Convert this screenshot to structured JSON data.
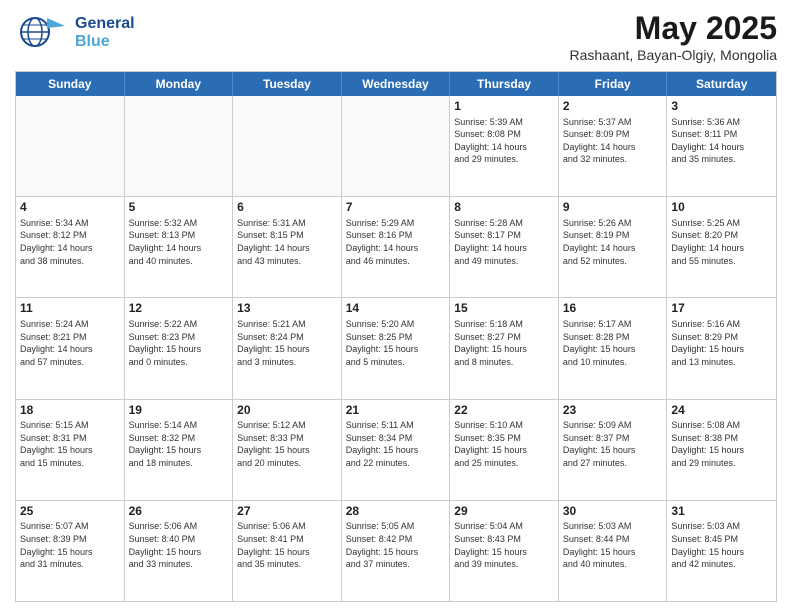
{
  "logo": {
    "general": "General",
    "blue": "Blue"
  },
  "title": "May 2025",
  "subtitle": "Rashaant, Bayan-Olgiy, Mongolia",
  "days": [
    "Sunday",
    "Monday",
    "Tuesday",
    "Wednesday",
    "Thursday",
    "Friday",
    "Saturday"
  ],
  "weeks": [
    [
      {
        "num": "",
        "info": ""
      },
      {
        "num": "",
        "info": ""
      },
      {
        "num": "",
        "info": ""
      },
      {
        "num": "",
        "info": ""
      },
      {
        "num": "1",
        "info": "Sunrise: 5:39 AM\nSunset: 8:08 PM\nDaylight: 14 hours\nand 29 minutes."
      },
      {
        "num": "2",
        "info": "Sunrise: 5:37 AM\nSunset: 8:09 PM\nDaylight: 14 hours\nand 32 minutes."
      },
      {
        "num": "3",
        "info": "Sunrise: 5:36 AM\nSunset: 8:11 PM\nDaylight: 14 hours\nand 35 minutes."
      }
    ],
    [
      {
        "num": "4",
        "info": "Sunrise: 5:34 AM\nSunset: 8:12 PM\nDaylight: 14 hours\nand 38 minutes."
      },
      {
        "num": "5",
        "info": "Sunrise: 5:32 AM\nSunset: 8:13 PM\nDaylight: 14 hours\nand 40 minutes."
      },
      {
        "num": "6",
        "info": "Sunrise: 5:31 AM\nSunset: 8:15 PM\nDaylight: 14 hours\nand 43 minutes."
      },
      {
        "num": "7",
        "info": "Sunrise: 5:29 AM\nSunset: 8:16 PM\nDaylight: 14 hours\nand 46 minutes."
      },
      {
        "num": "8",
        "info": "Sunrise: 5:28 AM\nSunset: 8:17 PM\nDaylight: 14 hours\nand 49 minutes."
      },
      {
        "num": "9",
        "info": "Sunrise: 5:26 AM\nSunset: 8:19 PM\nDaylight: 14 hours\nand 52 minutes."
      },
      {
        "num": "10",
        "info": "Sunrise: 5:25 AM\nSunset: 8:20 PM\nDaylight: 14 hours\nand 55 minutes."
      }
    ],
    [
      {
        "num": "11",
        "info": "Sunrise: 5:24 AM\nSunset: 8:21 PM\nDaylight: 14 hours\nand 57 minutes."
      },
      {
        "num": "12",
        "info": "Sunrise: 5:22 AM\nSunset: 8:23 PM\nDaylight: 15 hours\nand 0 minutes."
      },
      {
        "num": "13",
        "info": "Sunrise: 5:21 AM\nSunset: 8:24 PM\nDaylight: 15 hours\nand 3 minutes."
      },
      {
        "num": "14",
        "info": "Sunrise: 5:20 AM\nSunset: 8:25 PM\nDaylight: 15 hours\nand 5 minutes."
      },
      {
        "num": "15",
        "info": "Sunrise: 5:18 AM\nSunset: 8:27 PM\nDaylight: 15 hours\nand 8 minutes."
      },
      {
        "num": "16",
        "info": "Sunrise: 5:17 AM\nSunset: 8:28 PM\nDaylight: 15 hours\nand 10 minutes."
      },
      {
        "num": "17",
        "info": "Sunrise: 5:16 AM\nSunset: 8:29 PM\nDaylight: 15 hours\nand 13 minutes."
      }
    ],
    [
      {
        "num": "18",
        "info": "Sunrise: 5:15 AM\nSunset: 8:31 PM\nDaylight: 15 hours\nand 15 minutes."
      },
      {
        "num": "19",
        "info": "Sunrise: 5:14 AM\nSunset: 8:32 PM\nDaylight: 15 hours\nand 18 minutes."
      },
      {
        "num": "20",
        "info": "Sunrise: 5:12 AM\nSunset: 8:33 PM\nDaylight: 15 hours\nand 20 minutes."
      },
      {
        "num": "21",
        "info": "Sunrise: 5:11 AM\nSunset: 8:34 PM\nDaylight: 15 hours\nand 22 minutes."
      },
      {
        "num": "22",
        "info": "Sunrise: 5:10 AM\nSunset: 8:35 PM\nDaylight: 15 hours\nand 25 minutes."
      },
      {
        "num": "23",
        "info": "Sunrise: 5:09 AM\nSunset: 8:37 PM\nDaylight: 15 hours\nand 27 minutes."
      },
      {
        "num": "24",
        "info": "Sunrise: 5:08 AM\nSunset: 8:38 PM\nDaylight: 15 hours\nand 29 minutes."
      }
    ],
    [
      {
        "num": "25",
        "info": "Sunrise: 5:07 AM\nSunset: 8:39 PM\nDaylight: 15 hours\nand 31 minutes."
      },
      {
        "num": "26",
        "info": "Sunrise: 5:06 AM\nSunset: 8:40 PM\nDaylight: 15 hours\nand 33 minutes."
      },
      {
        "num": "27",
        "info": "Sunrise: 5:06 AM\nSunset: 8:41 PM\nDaylight: 15 hours\nand 35 minutes."
      },
      {
        "num": "28",
        "info": "Sunrise: 5:05 AM\nSunset: 8:42 PM\nDaylight: 15 hours\nand 37 minutes."
      },
      {
        "num": "29",
        "info": "Sunrise: 5:04 AM\nSunset: 8:43 PM\nDaylight: 15 hours\nand 39 minutes."
      },
      {
        "num": "30",
        "info": "Sunrise: 5:03 AM\nSunset: 8:44 PM\nDaylight: 15 hours\nand 40 minutes."
      },
      {
        "num": "31",
        "info": "Sunrise: 5:03 AM\nSunset: 8:45 PM\nDaylight: 15 hours\nand 42 minutes."
      }
    ]
  ]
}
